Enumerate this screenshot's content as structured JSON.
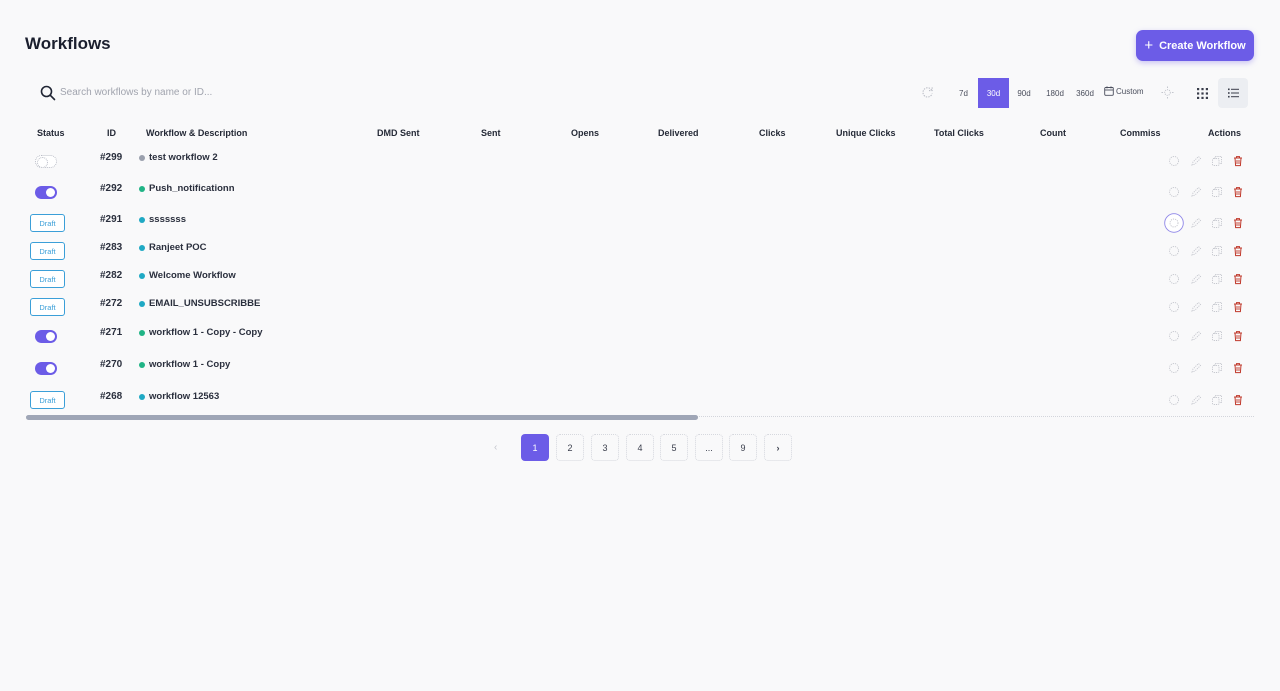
{
  "header": {
    "title": "Workflows",
    "create_label": "Create Workflow"
  },
  "search": {
    "placeholder": "Search workflows by name or ID..."
  },
  "filters": {
    "ranges": [
      "7d",
      "30d",
      "90d",
      "180d",
      "360d"
    ],
    "active_range": "30d",
    "custom_label": "Custom"
  },
  "table": {
    "columns": [
      "Status",
      "ID",
      "Workflow & Description",
      "DMD Sent",
      "Sent",
      "Opens",
      "Delivered",
      "Clicks",
      "Unique Clicks",
      "Total Clicks",
      "Count",
      "Commiss",
      "Actions"
    ],
    "rows": [
      {
        "status": "toggle-off",
        "id": "#299",
        "name": "test workflow 2",
        "dot_color": "#9aa0ad"
      },
      {
        "status": "toggle-on",
        "id": "#292",
        "name": "Push_notificationn",
        "dot_color": "#20b486"
      },
      {
        "status": "draft",
        "status_label": "Draft",
        "id": "#291",
        "name": "sssssss",
        "dot_color": "#1fa9c4"
      },
      {
        "status": "draft",
        "status_label": "Draft",
        "id": "#283",
        "name": "Ranjeet POC",
        "dot_color": "#1fa9c4"
      },
      {
        "status": "draft",
        "status_label": "Draft",
        "id": "#282",
        "name": "Welcome Workflow",
        "dot_color": "#1fa9c4"
      },
      {
        "status": "draft",
        "status_label": "Draft",
        "id": "#272",
        "name": "EMAIL_UNSUBSCRIBBE",
        "dot_color": "#1fa9c4"
      },
      {
        "status": "toggle-on",
        "id": "#271",
        "name": "workflow 1 - Copy - Copy",
        "dot_color": "#20b486"
      },
      {
        "status": "toggle-on",
        "id": "#270",
        "name": "workflow 1 - Copy",
        "dot_color": "#20b486"
      },
      {
        "status": "draft",
        "status_label": "Draft",
        "id": "#268",
        "name": "workflow 12563",
        "dot_color": "#1fa9c4"
      }
    ]
  },
  "pagination": {
    "pages": [
      "1",
      "2",
      "3",
      "4",
      "5",
      "...",
      "9"
    ],
    "current": "1",
    "next": "›",
    "prev": "‹"
  },
  "colors": {
    "accent": "#6c5ce7",
    "draft": "#3b9fd8",
    "delete": "#c0392b"
  }
}
